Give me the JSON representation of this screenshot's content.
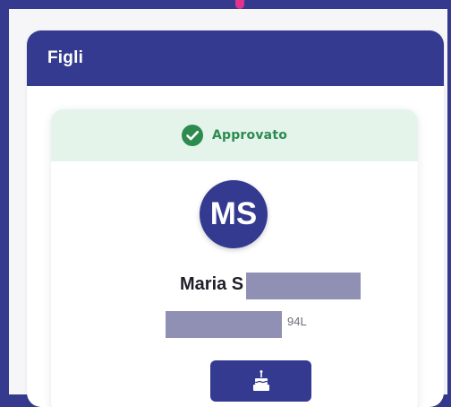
{
  "section": {
    "title": "Figli"
  },
  "child": {
    "status": "Approvato",
    "initials": "MS",
    "name": "Maria S",
    "fiscal_code": "94L"
  },
  "icons": {
    "status": "check-circle-icon",
    "birthday": "cake-icon"
  },
  "colors": {
    "primary": "#343a90",
    "status": "#2d8b4f",
    "status_bg": "#e4f4eb",
    "accent": "#e2338a"
  }
}
